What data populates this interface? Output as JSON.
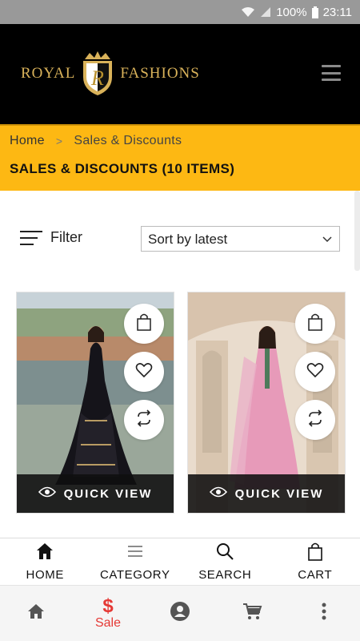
{
  "status_bar": {
    "battery": "100%",
    "time": "23:11"
  },
  "brand": {
    "left_word": "ROYAL",
    "right_word": "FASHIONS",
    "crest_letter": "R"
  },
  "breadcrumb": {
    "home": "Home",
    "separator": ">",
    "current": "Sales & Discounts"
  },
  "page_title": "SALES & DISCOUNTS (10 ITEMS)",
  "filter": {
    "label": "Filter"
  },
  "sort": {
    "selected": "Sort by latest"
  },
  "products": [
    {
      "quick_view_label": "QUICK VIEW",
      "dress_color": "#15141a"
    },
    {
      "quick_view_label": "QUICK VIEW",
      "dress_color": "#e79ab9"
    }
  ],
  "bottom_nav": [
    {
      "label": "HOME",
      "icon": "home-icon"
    },
    {
      "label": "CATEGORY",
      "icon": "menu-icon"
    },
    {
      "label": "SEARCH",
      "icon": "search-icon"
    },
    {
      "label": "CART",
      "icon": "bag-icon"
    }
  ],
  "system_nav": {
    "sale_symbol": "$",
    "sale_label": "Sale"
  },
  "colors": {
    "accent_yellow": "#fdb813",
    "header_black": "#000000",
    "logo_gold": "#d9b25a",
    "sale_red": "#e53935"
  }
}
